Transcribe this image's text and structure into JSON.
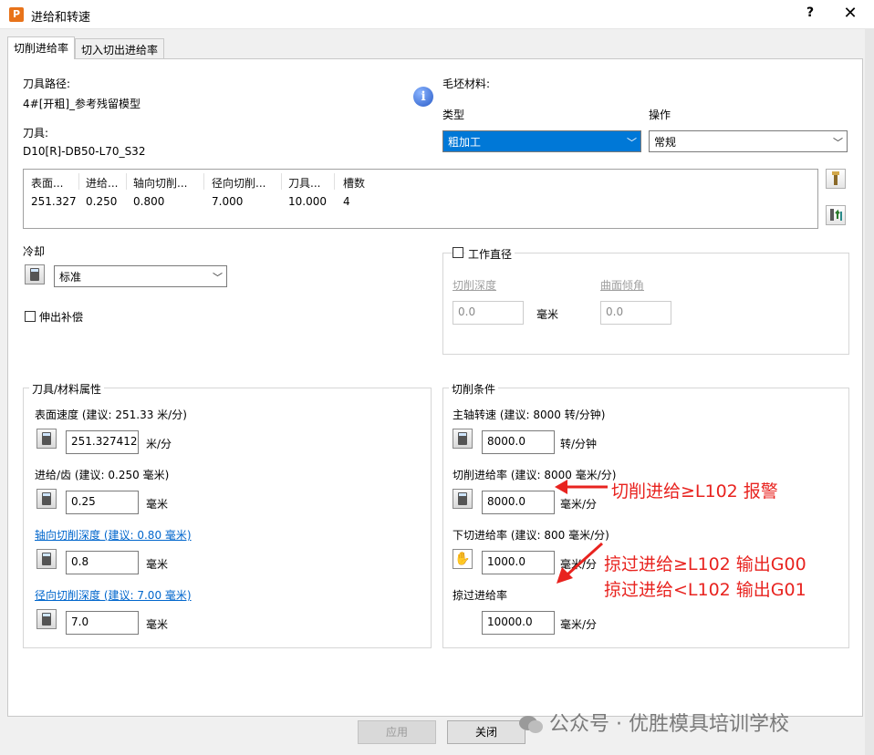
{
  "window": {
    "title": "进给和转速",
    "app_icon_letter": "P",
    "help": "?",
    "close": "✕"
  },
  "tabs": [
    {
      "label": "切削进给率",
      "active": true
    },
    {
      "label": "切入切出进给率",
      "active": false
    }
  ],
  "toolpath": {
    "label": "刀具路径:",
    "value": "4#[开粗]_参考残留模型"
  },
  "tool": {
    "label": "刀具:",
    "value": "D10[R]-DB50-L70_S32"
  },
  "stock_material": {
    "label": "毛坯材料:",
    "info_icon": "i",
    "type_label": "类型",
    "type_value": "粗加工",
    "operation_label": "操作",
    "operation_value": "常规"
  },
  "tool_table": {
    "headers": [
      "表面...",
      "进给...",
      "轴向切削...",
      "径向切削...",
      "刀具...",
      "槽数"
    ],
    "row": [
      "251.327",
      "0.250",
      "0.800",
      "7.000",
      "10.000",
      "4"
    ]
  },
  "coolant": {
    "label": "冷却",
    "value": "标准"
  },
  "extend_comp": {
    "label": "伸出补偿",
    "checked": false
  },
  "working_diameter": {
    "title": "工作直径",
    "checked": false,
    "cut_depth_label": "切削深度",
    "cut_depth_value": "0.0",
    "unit": "毫米",
    "surface_angle_label": "曲面倾角",
    "surface_angle_value": "0.0"
  },
  "tool_material": {
    "title": "刀具/材料属性",
    "surface_speed_label": "表面速度 (建议: 251.33 米/分)",
    "surface_speed_value": "251.327412",
    "surface_speed_unit": "米/分",
    "feed_per_tooth_label": "进给/齿 (建议: 0.250 毫米)",
    "feed_per_tooth_value": "0.25",
    "feed_per_tooth_unit": "毫米",
    "axial_depth_label": "轴向切削深度 (建议: 0.80 毫米)",
    "axial_depth_value": "0.8",
    "axial_depth_unit": "毫米",
    "radial_depth_label": "径向切削深度 (建议: 7.00 毫米)",
    "radial_depth_value": "7.0",
    "radial_depth_unit": "毫米"
  },
  "cutting_conditions": {
    "title": "切削条件",
    "spindle_label": "主轴转速 (建议: 8000 转/分钟)",
    "spindle_value": "8000.0",
    "spindle_unit": "转/分钟",
    "cut_feed_label": "切削进给率 (建议: 8000 毫米/分)",
    "cut_feed_value": "8000.0",
    "cut_feed_unit": "毫米/分",
    "plunge_label": "下切进给率 (建议: 800 毫米/分)",
    "plunge_value": "1000.0",
    "plunge_unit": "毫米/分",
    "skim_label": "掠过进给率",
    "skim_value": "10000.0",
    "skim_unit": "毫米/分"
  },
  "annotations": {
    "cut_feed_note": "切削进给≥L102 报警",
    "skim_note_1": "掠过进给≥L102 输出G00",
    "skim_note_2": "掠过进给<L102 输出G01"
  },
  "buttons": {
    "apply": "应用",
    "close": "关闭"
  },
  "watermark": "公众号 · 优胜模具培训学校",
  "colors": {
    "accent": "#0078d7",
    "annotation": "#e8231f",
    "link": "#0066cc"
  }
}
